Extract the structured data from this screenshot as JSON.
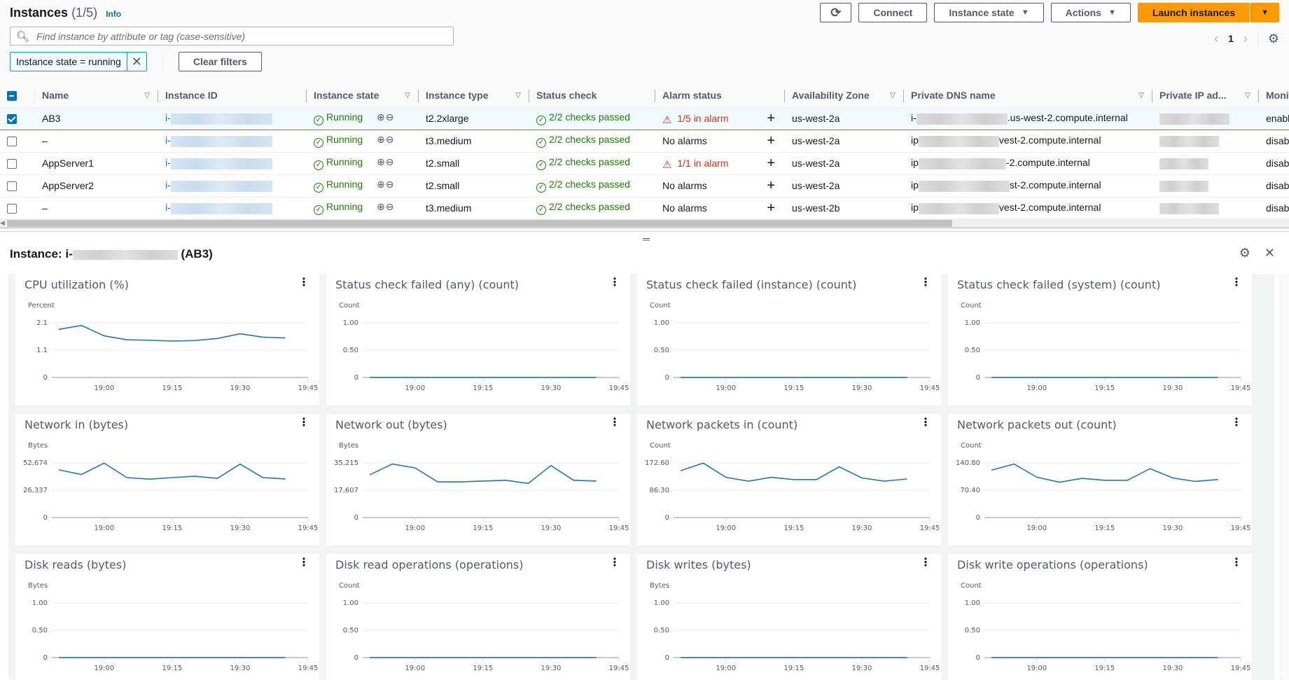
{
  "header": {
    "title": "Instances",
    "count": "(1/5)",
    "info_label": "Info"
  },
  "toolbar": {
    "refresh_icon": "refresh-icon",
    "connect_label": "Connect",
    "instance_state_label": "Instance state",
    "actions_label": "Actions",
    "launch_label": "Launch instances"
  },
  "search": {
    "placeholder": "Find instance by attribute or tag (case-sensitive)",
    "value": ""
  },
  "pagination": {
    "current_page": "1"
  },
  "filters": {
    "token": "Instance state = running",
    "clear_label": "Clear filters"
  },
  "table": {
    "columns": [
      "Name",
      "Instance ID",
      "Instance state",
      "Instance type",
      "Status check",
      "Alarm status",
      "Availability Zone",
      "Private DNS name",
      "Private IP ad...",
      "Monitoring"
    ],
    "rows": [
      {
        "selected": true,
        "name": "AB3",
        "id_prefix": "i-",
        "state": "Running",
        "type": "t2.2xlarge",
        "status": "2/2 checks passed",
        "alarm": "1/5 in alarm",
        "alarm_active": true,
        "az": "us-west-2a",
        "dns_prefix": "i-",
        "dns_suffix": ".us-west-2.compute.internal",
        "monitoring": "enabled"
      },
      {
        "selected": false,
        "name": "–",
        "id_prefix": "i-",
        "state": "Running",
        "type": "t3.medium",
        "status": "2/2 checks passed",
        "alarm": "No alarms",
        "alarm_active": false,
        "az": "us-west-2a",
        "dns_prefix": "ip",
        "dns_suffix": "vest-2.compute.internal",
        "monitoring": "disabled"
      },
      {
        "selected": false,
        "name": "AppServer1",
        "id_prefix": "i-",
        "state": "Running",
        "type": "t2.small",
        "status": "2/2 checks passed",
        "alarm": "1/1 in alarm",
        "alarm_active": true,
        "az": "us-west-2a",
        "dns_prefix": "ip",
        "dns_suffix": "-2.compute.internal",
        "monitoring": "disabled"
      },
      {
        "selected": false,
        "name": "AppServer2",
        "id_prefix": "i-",
        "state": "Running",
        "type": "t2.small",
        "status": "2/2 checks passed",
        "alarm": "No alarms",
        "alarm_active": false,
        "az": "us-west-2a",
        "dns_prefix": "ip",
        "dns_suffix": "st-2.compute.internal",
        "monitoring": "disabled"
      },
      {
        "selected": false,
        "name": "–",
        "id_prefix": "i-",
        "state": "Running",
        "type": "t3.medium",
        "status": "2/2 checks passed",
        "alarm": "No alarms",
        "alarm_active": false,
        "az": "us-west-2b",
        "dns_prefix": "ip",
        "dns_suffix": "vest-2.compute.internal",
        "monitoring": "disabled"
      }
    ]
  },
  "detail": {
    "title_prefix": "Instance: i-",
    "title_suffix": "(AB3)"
  },
  "colors": {
    "primary": "#ff9900",
    "link": "#0073bb",
    "success": "#1d8102",
    "error": "#d13212",
    "series": "#1f77b4"
  },
  "chart_data": [
    {
      "type": "line",
      "title": "CPU utilization (%)",
      "ylabel": "Percent",
      "yticks": [
        "0",
        "1.1",
        "2.1"
      ],
      "ylim": [
        0,
        2.1
      ],
      "xticks": [
        "19:00",
        "19:15",
        "19:30",
        "19:45"
      ],
      "x": [
        "18:50",
        "18:55",
        "19:00",
        "19:05",
        "19:10",
        "19:15",
        "19:20",
        "19:25",
        "19:30",
        "19:35",
        "19:40"
      ],
      "values": [
        1.85,
        2.0,
        1.6,
        1.45,
        1.43,
        1.4,
        1.42,
        1.5,
        1.68,
        1.55,
        1.52
      ]
    },
    {
      "type": "line",
      "title": "Status check failed (any) (count)",
      "ylabel": "Count",
      "yticks": [
        "0",
        "0.50",
        "1.00"
      ],
      "ylim": [
        0,
        1
      ],
      "xticks": [
        "19:00",
        "19:15",
        "19:30",
        "19:45"
      ],
      "x": [
        "18:50",
        "18:55",
        "19:00",
        "19:05",
        "19:10",
        "19:15",
        "19:20",
        "19:25",
        "19:30",
        "19:35",
        "19:40"
      ],
      "values": [
        0,
        0,
        0,
        0,
        0,
        0,
        0,
        0,
        0,
        0,
        0
      ]
    },
    {
      "type": "line",
      "title": "Status check failed (instance) (count)",
      "ylabel": "Count",
      "yticks": [
        "0",
        "0.50",
        "1.00"
      ],
      "ylim": [
        0,
        1
      ],
      "xticks": [
        "19:00",
        "19:15",
        "19:30",
        "19:45"
      ],
      "x": [
        "18:50",
        "18:55",
        "19:00",
        "19:05",
        "19:10",
        "19:15",
        "19:20",
        "19:25",
        "19:30",
        "19:35",
        "19:40"
      ],
      "values": [
        0,
        0,
        0,
        0,
        0,
        0,
        0,
        0,
        0,
        0,
        0
      ]
    },
    {
      "type": "line",
      "title": "Status check failed (system) (count)",
      "ylabel": "Count",
      "yticks": [
        "0",
        "0.50",
        "1.00"
      ],
      "ylim": [
        0,
        1
      ],
      "xticks": [
        "19:00",
        "19:15",
        "19:30",
        "19:45"
      ],
      "x": [
        "18:50",
        "18:55",
        "19:00",
        "19:05",
        "19:10",
        "19:15",
        "19:20",
        "19:25",
        "19:30",
        "19:35",
        "19:40"
      ],
      "values": [
        0,
        0,
        0,
        0,
        0,
        0,
        0,
        0,
        0,
        0,
        0
      ]
    },
    {
      "type": "line",
      "title": "Network in (bytes)",
      "ylabel": "Bytes",
      "yticks": [
        "0",
        "26,337",
        "52,674"
      ],
      "ylim": [
        0,
        52674
      ],
      "xticks": [
        "19:00",
        "19:15",
        "19:30",
        "19:45"
      ],
      "x": [
        "18:50",
        "18:55",
        "19:00",
        "19:05",
        "19:10",
        "19:15",
        "19:20",
        "19:25",
        "19:30",
        "19:35",
        "19:40"
      ],
      "values": [
        46000,
        41500,
        52500,
        38500,
        37000,
        38500,
        39800,
        37800,
        51500,
        38500,
        37200
      ]
    },
    {
      "type": "line",
      "title": "Network out (bytes)",
      "ylabel": "Bytes",
      "yticks": [
        "0",
        "17,607",
        "35,215"
      ],
      "ylim": [
        0,
        35215
      ],
      "xticks": [
        "19:00",
        "19:15",
        "19:30",
        "19:45"
      ],
      "x": [
        "18:50",
        "18:55",
        "19:00",
        "19:05",
        "19:10",
        "19:15",
        "19:20",
        "19:25",
        "19:30",
        "19:35",
        "19:40"
      ],
      "values": [
        27500,
        34500,
        32000,
        23000,
        23000,
        23500,
        24000,
        22000,
        33500,
        24000,
        23500
      ]
    },
    {
      "type": "line",
      "title": "Network packets in (count)",
      "ylabel": "Count",
      "yticks": [
        "0",
        "86.30",
        "172.60"
      ],
      "ylim": [
        0,
        172.6
      ],
      "xticks": [
        "19:00",
        "19:15",
        "19:30",
        "19:45"
      ],
      "x": [
        "18:50",
        "18:55",
        "19:00",
        "19:05",
        "19:10",
        "19:15",
        "19:20",
        "19:25",
        "19:30",
        "19:35",
        "19:40"
      ],
      "values": [
        148,
        172,
        127,
        115,
        127,
        120,
        120,
        160,
        125,
        115,
        122
      ]
    },
    {
      "type": "line",
      "title": "Network packets out (count)",
      "ylabel": "Count",
      "yticks": [
        "0",
        "70.40",
        "140.80"
      ],
      "ylim": [
        0,
        140.8
      ],
      "xticks": [
        "19:00",
        "19:15",
        "19:30",
        "19:45"
      ],
      "x": [
        "18:50",
        "18:55",
        "19:00",
        "19:05",
        "19:10",
        "19:15",
        "19:20",
        "19:25",
        "19:30",
        "19:35",
        "19:40"
      ],
      "values": [
        122,
        138,
        104,
        91,
        101,
        96,
        96,
        126,
        102,
        93,
        98
      ]
    },
    {
      "type": "line",
      "title": "Disk reads (bytes)",
      "ylabel": "Bytes",
      "yticks": [
        "0",
        "0.50",
        "1.00"
      ],
      "ylim": [
        0,
        1
      ],
      "xticks": [
        "19:00",
        "19:15",
        "19:30",
        "19:45"
      ],
      "x": [
        "18:50",
        "18:55",
        "19:00",
        "19:05",
        "19:10",
        "19:15",
        "19:20",
        "19:25",
        "19:30",
        "19:35",
        "19:40"
      ],
      "values": [
        0,
        0,
        0,
        0,
        0,
        0,
        0,
        0,
        0,
        0,
        0
      ]
    },
    {
      "type": "line",
      "title": "Disk read operations (operations)",
      "ylabel": "Count",
      "yticks": [
        "0",
        "0.50",
        "1.00"
      ],
      "ylim": [
        0,
        1
      ],
      "xticks": [
        "19:00",
        "19:15",
        "19:30",
        "19:45"
      ],
      "x": [
        "18:50",
        "18:55",
        "19:00",
        "19:05",
        "19:10",
        "19:15",
        "19:20",
        "19:25",
        "19:30",
        "19:35",
        "19:40"
      ],
      "values": [
        0,
        0,
        0,
        0,
        0,
        0,
        0,
        0,
        0,
        0,
        0
      ]
    },
    {
      "type": "line",
      "title": "Disk writes (bytes)",
      "ylabel": "Bytes",
      "yticks": [
        "0",
        "0.50",
        "1.00"
      ],
      "ylim": [
        0,
        1
      ],
      "xticks": [
        "19:00",
        "19:15",
        "19:30",
        "19:45"
      ],
      "x": [
        "18:50",
        "18:55",
        "19:00",
        "19:05",
        "19:10",
        "19:15",
        "19:20",
        "19:25",
        "19:30",
        "19:35",
        "19:40"
      ],
      "values": [
        0,
        0,
        0,
        0,
        0,
        0,
        0,
        0,
        0,
        0,
        0
      ]
    },
    {
      "type": "line",
      "title": "Disk write operations (operations)",
      "ylabel": "Count",
      "yticks": [
        "0",
        "0.50",
        "1.00"
      ],
      "ylim": [
        0,
        1
      ],
      "xticks": [
        "19:00",
        "19:15",
        "19:30",
        "19:45"
      ],
      "x": [
        "18:50",
        "18:55",
        "19:00",
        "19:05",
        "19:10",
        "19:15",
        "19:20",
        "19:25",
        "19:30",
        "19:35",
        "19:40"
      ],
      "values": [
        0,
        0,
        0,
        0,
        0,
        0,
        0,
        0,
        0,
        0,
        0
      ]
    }
  ]
}
